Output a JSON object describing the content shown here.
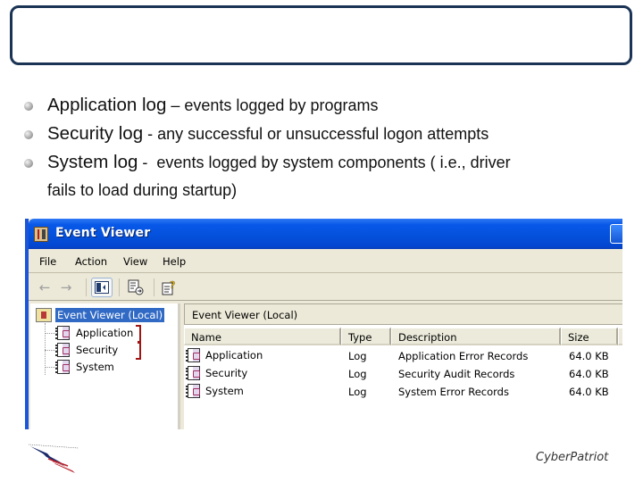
{
  "slide": {
    "title": "",
    "bullets": [
      {
        "lead": "Application log",
        "separator": " – ",
        "rest": "events logged by programs",
        "continuation": ""
      },
      {
        "lead": "Security log",
        "separator": " - ",
        "rest": "any successful or unsuccessful logon attempts",
        "continuation": ""
      },
      {
        "lead": "System log",
        "separator": " -  ",
        "rest": "events logged by system components ( i.e., driver",
        "continuation": "fails to load during startup)"
      }
    ],
    "footer_logo_text": "CyberPatriot",
    "left_logo": "flag-emblem-icon"
  },
  "window": {
    "title": "Event Viewer",
    "menu": [
      "File",
      "Action",
      "View",
      "Help"
    ],
    "toolbar": [
      "back-icon",
      "forward-icon",
      "show-hide-tree-icon",
      "export-list-icon",
      "help-icon"
    ],
    "tree": {
      "root": "Event Viewer (Local)",
      "items": [
        "Application",
        "Security",
        "System"
      ]
    },
    "right_pane": {
      "header": "Event Viewer (Local)",
      "columns": [
        "Name",
        "Type",
        "Description",
        "Size"
      ],
      "rows": [
        {
          "name": "Application",
          "type": "Log",
          "description": "Application Error Records",
          "size": "64.0 KB"
        },
        {
          "name": "Security",
          "type": "Log",
          "description": "Security Audit Records",
          "size": "64.0 KB"
        },
        {
          "name": "System",
          "type": "Log",
          "description": "System Error Records",
          "size": "64.0 KB"
        }
      ]
    }
  },
  "colors": {
    "title_border": "#1b3455",
    "xp_title_blue": "#0450da",
    "selection": "#316ac5",
    "annotation_bracket": "#a01414"
  }
}
